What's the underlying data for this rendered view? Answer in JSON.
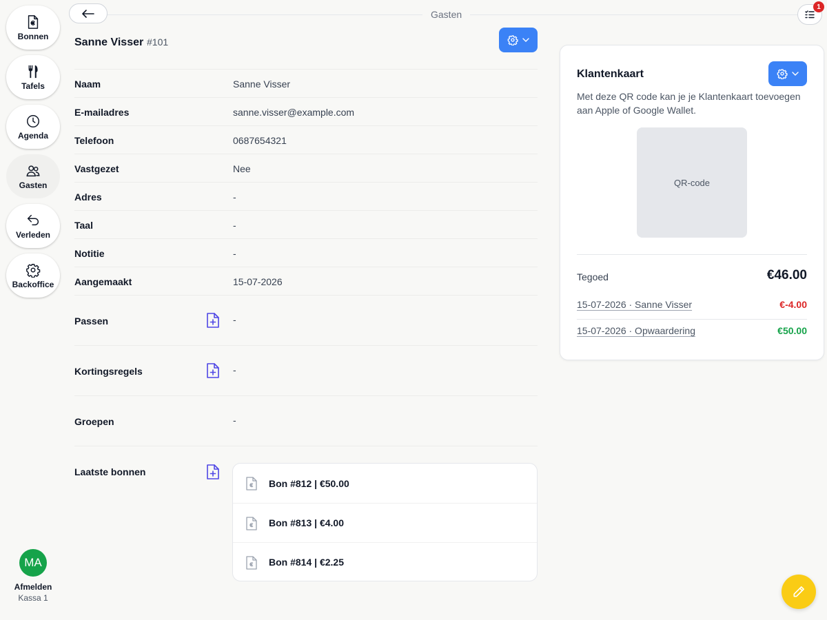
{
  "sidebar": {
    "items": [
      {
        "label": "Bonnen",
        "icon": "receipt-euro-icon"
      },
      {
        "label": "Tafels",
        "icon": "cutlery-icon"
      },
      {
        "label": "Agenda",
        "icon": "clock-icon"
      },
      {
        "label": "Gasten",
        "icon": "users-icon",
        "active": true
      },
      {
        "label": "Verleden",
        "icon": "undo-arrow-icon"
      },
      {
        "label": "Backoffice",
        "icon": "gear-icon"
      }
    ],
    "user": {
      "initials": "MA",
      "logout_label": "Afmelden",
      "register": "Kassa 1"
    }
  },
  "topbar": {
    "title": "Gasten",
    "notification_count": "1"
  },
  "guest": {
    "name": "Sanne Visser",
    "id": "#101",
    "fields": [
      {
        "label": "Naam",
        "value": "Sanne Visser"
      },
      {
        "label": "E-mailadres",
        "value": "sanne.visser@example.com"
      },
      {
        "label": "Telefoon",
        "value": "0687654321"
      },
      {
        "label": "Vastgezet",
        "value": "Nee"
      },
      {
        "label": "Adres",
        "value": "-"
      },
      {
        "label": "Taal",
        "value": "-"
      },
      {
        "label": "Notitie",
        "value": "-"
      },
      {
        "label": "Aangemaakt",
        "value": "15-07-2026"
      }
    ],
    "sections": {
      "passen": {
        "label": "Passen",
        "value": "-"
      },
      "kortingsregels": {
        "label": "Kortingsregels",
        "value": "-"
      },
      "groepen": {
        "label": "Groepen",
        "value": "-"
      },
      "laatste_bonnen": {
        "label": "Laatste bonnen",
        "items": [
          "Bon #812 | €50.00",
          "Bon #813 | €4.00",
          "Bon #814 | €2.25"
        ]
      }
    }
  },
  "loyalty_card": {
    "title": "Klantenkaart",
    "description": "Met deze QR code kan je je Klantenkaart toevoegen aan Apple of Google Wallet.",
    "qr_label": "QR-code",
    "balance_label": "Tegoed",
    "balance": "€46.00",
    "transactions": [
      {
        "description": "15-07-2026 · Sanne Visser",
        "amount": "€-4.00",
        "status": "negative"
      },
      {
        "description": "15-07-2026 · Opwaardering",
        "amount": "€50.00",
        "status": "positive"
      }
    ]
  },
  "colors": {
    "accent": "#3b82f6",
    "fab": "#facc15",
    "avatar": "#16a34a",
    "negative": "#dc2626",
    "positive": "#16a34a"
  }
}
